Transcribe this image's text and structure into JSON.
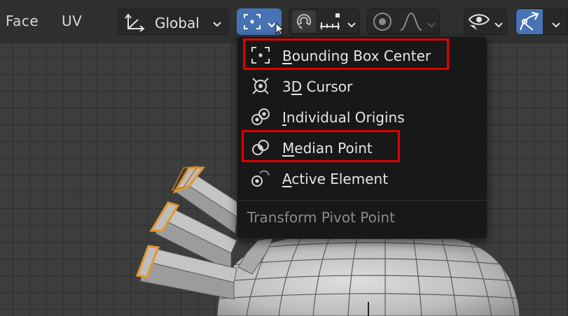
{
  "header": {
    "menus": [
      {
        "label": "Face"
      },
      {
        "label": "UV"
      }
    ],
    "transform_orientation": {
      "label": "Global"
    },
    "pivot_point_button": {
      "state": "active",
      "icon": "bounding-box-center-icon"
    },
    "snap_icon": "magnet-icon",
    "snap_target_icon": "snap-increment-icon",
    "proportional_editing_icon": "proportional-editing-icon",
    "falloff_icon": "falloff-curve-icon",
    "overlays_icon": "eye-icon",
    "gizmo_icon": "gizmo-icon"
  },
  "pivot_menu": {
    "items": [
      {
        "mnemonic": "B",
        "rest": "ounding Box Center",
        "icon": "bounding-box-center-icon",
        "highlighted": true
      },
      {
        "prefix": "3",
        "mnemonic": "D",
        "rest": " Cursor",
        "icon": "3d-cursor-icon",
        "highlighted": false
      },
      {
        "mnemonic": "I",
        "rest": "ndividual Origins",
        "icon": "individual-origins-icon",
        "highlighted": false
      },
      {
        "mnemonic": "M",
        "rest": "edian Point",
        "icon": "median-point-icon",
        "highlighted": true
      },
      {
        "mnemonic": "A",
        "rest": "ctive Element",
        "icon": "active-element-icon",
        "highlighted": false
      }
    ],
    "footer": "Transform Pivot Point"
  },
  "colors": {
    "accent": "#4772b3",
    "highlight_box": "#e00000",
    "menu_bg": "#181818",
    "header_bg": "#303030",
    "viewport_bg": "#3d3d3d",
    "selected_edge": "#e0962e"
  }
}
